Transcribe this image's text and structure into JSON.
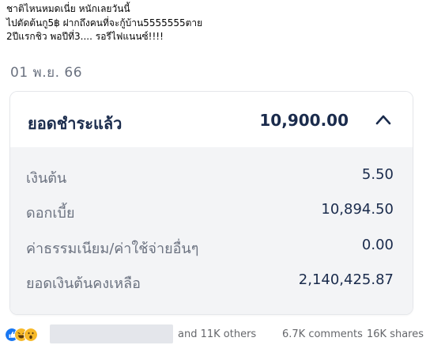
{
  "post": {
    "lines": [
      "ชาติไหนหมดเนี่ย หนักเลยวันนี้",
      "ไปตัดต้นกู5฿ ฝากถึงคนที่จะกู้บ้าน5555555ตาย",
      "2ปีแรกชิว พอปีที่3.... รอรีไฟแนนซ์!!!!"
    ]
  },
  "statement": {
    "date": "01 พ.ย. 66",
    "paid_label": "ยอดชำระแล้ว",
    "paid_amount": "10,900.00",
    "rows": [
      {
        "label": "เงินต้น",
        "value": "5.50"
      },
      {
        "label": "ดอกเบี้ย",
        "value": "10,894.50"
      },
      {
        "label": "ค่าธรรมเนียม/ค่าใช้จ่ายอื่นๆ",
        "value": "0.00"
      },
      {
        "label": "ยอดเงินต้นคงเหลือ",
        "value": "2,140,425.87"
      }
    ]
  },
  "footer": {
    "reactions": [
      "like-icon",
      "haha-icon",
      "wow-icon"
    ],
    "others": "and 11K others",
    "comments": "6.7K comments",
    "shares": "16K shares"
  },
  "colors": {
    "navy": "#1a2b4c",
    "muted": "#6b7280",
    "like": "#1877f2",
    "emoji": "#f7b928"
  }
}
